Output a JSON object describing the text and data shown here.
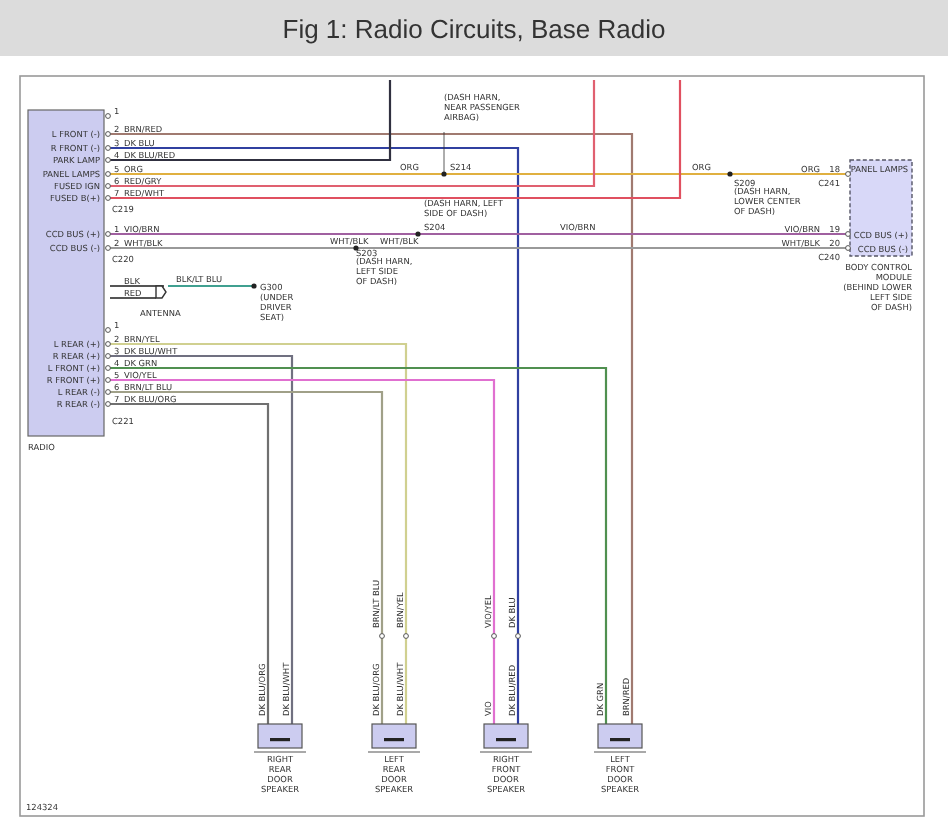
{
  "header": {
    "title": "Fig 1: Radio Circuits, Base Radio"
  },
  "radio": {
    "name": "RADIO",
    "connectors": [
      {
        "name": "C219",
        "pins": [
          {
            "number": "1"
          },
          {
            "number": "2",
            "function": "L FRONT (-)",
            "wire": "BRN/RED"
          },
          {
            "number": "3",
            "function": "R FRONT (-)",
            "wire": "DK BLU"
          },
          {
            "number": "4",
            "function": "PARK LAMP",
            "wire": "DK BLU/RED"
          },
          {
            "number": "5",
            "function": "PANEL LAMPS",
            "wire": "ORG"
          },
          {
            "number": "6",
            "function": "FUSED IGN",
            "wire": "RED/GRY"
          },
          {
            "number": "7",
            "function": "FUSED B(+)",
            "wire": "RED/WHT"
          }
        ]
      },
      {
        "name": "C220",
        "pins": [
          {
            "number": "1",
            "function": "CCD BUS (+)",
            "wire": "VIO/BRN"
          },
          {
            "number": "2",
            "function": "CCD BUS (-)",
            "wire": "WHT/BLK"
          }
        ]
      },
      {
        "name": "C221",
        "pins": [
          {
            "number": "1"
          },
          {
            "number": "2",
            "function": "L REAR (+)",
            "wire": "BRN/YEL"
          },
          {
            "number": "3",
            "function": "R REAR (+)",
            "wire": "DK BLU/WHT"
          },
          {
            "number": "4",
            "function": "L FRONT (+)",
            "wire": "DK GRN"
          },
          {
            "number": "5",
            "function": "R FRONT (+)",
            "wire": "VIO/YEL"
          },
          {
            "number": "6",
            "function": "L REAR (-)",
            "wire": "BRN/LT BLU"
          },
          {
            "number": "7",
            "function": "R REAR (-)",
            "wire": "DK BLU/ORG"
          }
        ]
      }
    ]
  },
  "antenna": {
    "label": "ANTENNA",
    "leads": [
      "BLK",
      "RED"
    ]
  },
  "ground": {
    "wire": "BLK/LT BLU",
    "name": "G300",
    "note": [
      "(UNDER",
      "DRIVER",
      "SEAT)"
    ]
  },
  "splices": [
    {
      "name": "S214",
      "note": [
        "(DASH HARN,",
        "NEAR PASSENGER",
        "AIRBAG)"
      ]
    },
    {
      "name": "S204",
      "note": [
        "(DASH HARN, LEFT",
        "SIDE OF DASH)"
      ]
    },
    {
      "name": "S203",
      "note": [
        "(DASH HARN,",
        "LEFT SIDE",
        "OF DASH)"
      ]
    },
    {
      "name": "S209",
      "note": [
        "(DASH HARN,",
        "LOWER CENTER",
        "OF DASH)"
      ]
    }
  ],
  "run_labels": [
    "ORG",
    "ORG",
    "VIO/BRN",
    "WHT/BLK",
    "WHT/BLK"
  ],
  "bcm": {
    "name": [
      "BODY CONTROL",
      "MODULE",
      "(BEHIND LOWER",
      "LEFT SIDE",
      "OF DASH)"
    ],
    "connectors": [
      "C241",
      "C240"
    ],
    "pins": [
      {
        "number": "18",
        "function": "PANEL LAMPS",
        "wire": "ORG"
      },
      {
        "number": "19",
        "function": "CCD BUS (+)",
        "wire": "VIO/BRN"
      },
      {
        "number": "20",
        "function": "CCD BUS (-)",
        "wire": "WHT/BLK"
      }
    ]
  },
  "speakers": [
    {
      "name": [
        "RIGHT",
        "REAR",
        "DOOR",
        "SPEAKER"
      ],
      "lower_wires": [
        "DK BLU/ORG",
        "DK BLU/WHT"
      ]
    },
    {
      "name": [
        "LEFT",
        "REAR",
        "DOOR",
        "SPEAKER"
      ],
      "upper_wires": [
        "BRN/LT BLU",
        "BRN/YEL"
      ],
      "lower_wires": [
        "DK BLU/ORG",
        "DK BLU/WHT"
      ]
    },
    {
      "name": [
        "RIGHT",
        "FRONT",
        "DOOR",
        "SPEAKER"
      ],
      "upper_wires": [
        "VIO/YEL",
        "DK BLU"
      ],
      "lower_wires": [
        "VIO",
        "DK BLU/RED"
      ]
    },
    {
      "name": [
        "LEFT",
        "FRONT",
        "DOOR",
        "SPEAKER"
      ],
      "lower_wires": [
        "DK GRN",
        "BRN/RED"
      ]
    }
  ],
  "figure_code": "124324"
}
